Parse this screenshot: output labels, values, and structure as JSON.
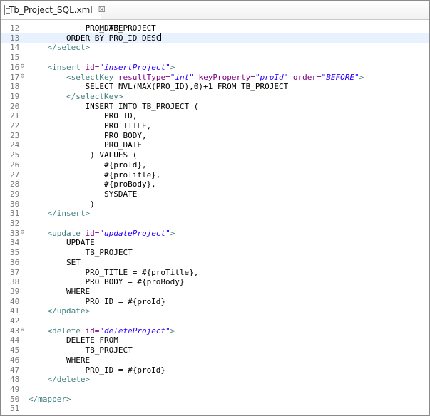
{
  "tab": {
    "title": "Tb_Project_SQL.xml",
    "close": "☒"
  },
  "fold_glyph": "⊖",
  "partial_top": "PRO_DATE",
  "lines": [
    {
      "n": "12",
      "segs": [
        [
          "t",
          "            FROM TB_PROJECT"
        ]
      ]
    },
    {
      "n": "13",
      "current": true,
      "segs": [
        [
          "t",
          "        ORDER BY PRO_ID DESC"
        ]
      ],
      "caret": true
    },
    {
      "n": "14",
      "segs": [
        [
          "t",
          "    "
        ],
        [
          "tag",
          "</select>"
        ]
      ]
    },
    {
      "n": "15",
      "segs": []
    },
    {
      "n": "16",
      "fold": true,
      "segs": [
        [
          "t",
          "    "
        ],
        [
          "tag",
          "<insert "
        ],
        [
          "attr",
          "id="
        ],
        [
          "val",
          "\"insertProject\""
        ],
        [
          "tag",
          ">"
        ]
      ]
    },
    {
      "n": "17",
      "fold": true,
      "segs": [
        [
          "t",
          "        "
        ],
        [
          "tag",
          "<selectKey "
        ],
        [
          "attr",
          "resultType="
        ],
        [
          "val",
          "\"int\""
        ],
        [
          "t",
          " "
        ],
        [
          "attr",
          "keyProperty="
        ],
        [
          "val",
          "\"proId\""
        ],
        [
          "t",
          " "
        ],
        [
          "attr",
          "order="
        ],
        [
          "val",
          "\"BEFORE\""
        ],
        [
          "tag",
          ">"
        ]
      ]
    },
    {
      "n": "18",
      "segs": [
        [
          "t",
          "            SELECT NVL(MAX(PRO_ID),0)+1 FROM TB_PROJECT"
        ]
      ]
    },
    {
      "n": "19",
      "segs": [
        [
          "t",
          "        "
        ],
        [
          "tag",
          "</selectKey>"
        ]
      ]
    },
    {
      "n": "20",
      "segs": [
        [
          "t",
          "            INSERT INTO TB_PROJECT ("
        ]
      ]
    },
    {
      "n": "21",
      "segs": [
        [
          "t",
          "                PRO_ID,"
        ]
      ]
    },
    {
      "n": "22",
      "segs": [
        [
          "t",
          "                PRO_TITLE,"
        ]
      ]
    },
    {
      "n": "23",
      "segs": [
        [
          "t",
          "                PRO_BODY,"
        ]
      ]
    },
    {
      "n": "24",
      "segs": [
        [
          "t",
          "                PRO_DATE"
        ]
      ]
    },
    {
      "n": "25",
      "segs": [
        [
          "t",
          "             ) VALUES ("
        ]
      ]
    },
    {
      "n": "26",
      "segs": [
        [
          "t",
          "                #{proId},"
        ]
      ]
    },
    {
      "n": "27",
      "segs": [
        [
          "t",
          "                #{proTitle},"
        ]
      ]
    },
    {
      "n": "28",
      "segs": [
        [
          "t",
          "                #{proBody},"
        ]
      ]
    },
    {
      "n": "29",
      "segs": [
        [
          "t",
          "                SYSDATE"
        ]
      ]
    },
    {
      "n": "30",
      "segs": [
        [
          "t",
          "             )"
        ]
      ]
    },
    {
      "n": "31",
      "segs": [
        [
          "t",
          "    "
        ],
        [
          "tag",
          "</insert>"
        ]
      ]
    },
    {
      "n": "32",
      "segs": []
    },
    {
      "n": "33",
      "fold": true,
      "segs": [
        [
          "t",
          "    "
        ],
        [
          "tag",
          "<update "
        ],
        [
          "attr",
          "id="
        ],
        [
          "val",
          "\"updateProject\""
        ],
        [
          "tag",
          ">"
        ]
      ]
    },
    {
      "n": "34",
      "segs": [
        [
          "t",
          "        UPDATE"
        ]
      ]
    },
    {
      "n": "35",
      "segs": [
        [
          "t",
          "            TB_PROJECT"
        ]
      ]
    },
    {
      "n": "36",
      "segs": [
        [
          "t",
          "        SET"
        ]
      ]
    },
    {
      "n": "37",
      "segs": [
        [
          "t",
          "            PRO_TITLE = #{proTitle},"
        ]
      ]
    },
    {
      "n": "38",
      "segs": [
        [
          "t",
          "            PRO_BODY = #{proBody}"
        ]
      ]
    },
    {
      "n": "39",
      "segs": [
        [
          "t",
          "        WHERE"
        ]
      ]
    },
    {
      "n": "40",
      "segs": [
        [
          "t",
          "            PRO_ID = #{proId}"
        ]
      ]
    },
    {
      "n": "41",
      "segs": [
        [
          "t",
          "    "
        ],
        [
          "tag",
          "</update>"
        ]
      ]
    },
    {
      "n": "42",
      "segs": []
    },
    {
      "n": "43",
      "fold": true,
      "segs": [
        [
          "t",
          "    "
        ],
        [
          "tag",
          "<delete "
        ],
        [
          "attr",
          "id="
        ],
        [
          "val",
          "\"deleteProject\""
        ],
        [
          "tag",
          ">"
        ]
      ]
    },
    {
      "n": "44",
      "segs": [
        [
          "t",
          "        DELETE FROM"
        ]
      ]
    },
    {
      "n": "45",
      "segs": [
        [
          "t",
          "            TB_PROJECT"
        ]
      ]
    },
    {
      "n": "46",
      "segs": [
        [
          "t",
          "        WHERE"
        ]
      ]
    },
    {
      "n": "47",
      "segs": [
        [
          "t",
          "            PRO_ID = #{proId}"
        ]
      ]
    },
    {
      "n": "48",
      "segs": [
        [
          "t",
          "    "
        ],
        [
          "tag",
          "</delete>"
        ]
      ]
    },
    {
      "n": "49",
      "segs": []
    },
    {
      "n": "50",
      "segs": [
        [
          "tag",
          "</mapper>"
        ]
      ]
    },
    {
      "n": "51",
      "segs": []
    }
  ]
}
